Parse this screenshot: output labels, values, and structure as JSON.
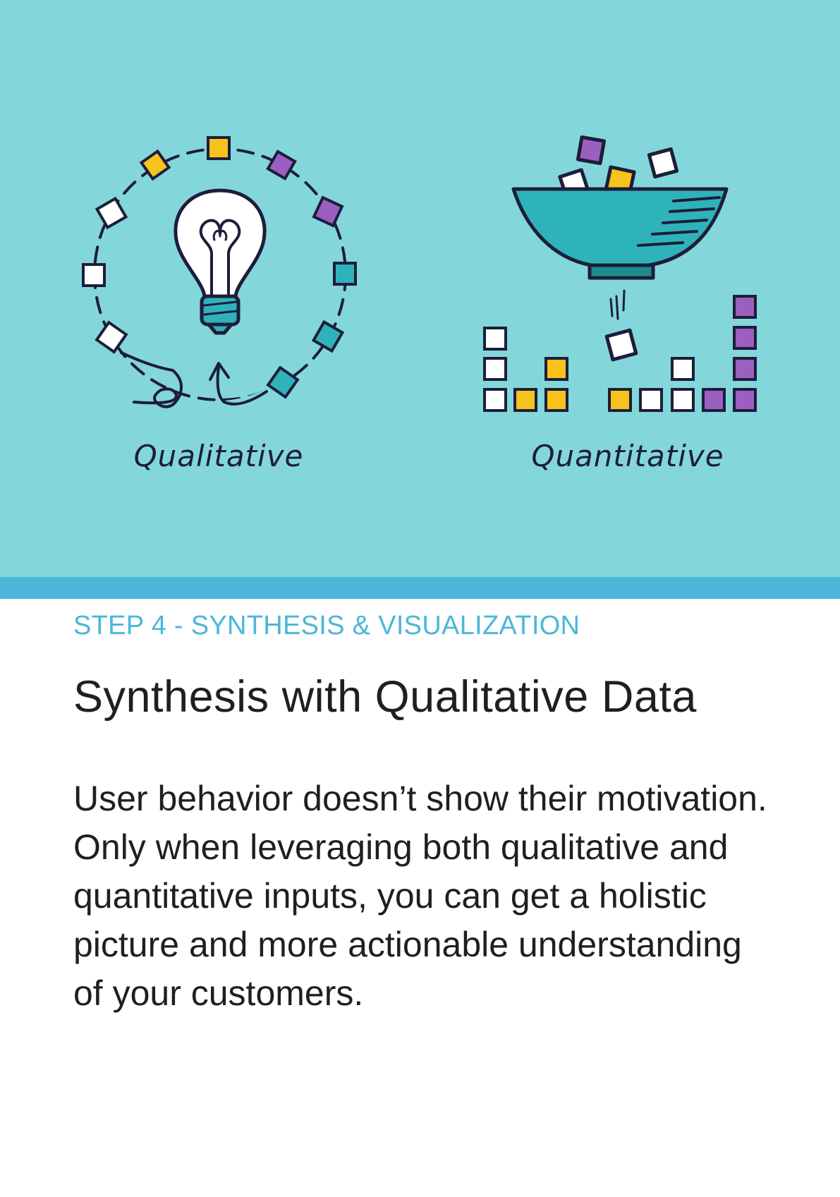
{
  "illustration": {
    "qualitative_label": "Qualitative",
    "quantitative_label": "Quantitative",
    "icons": [
      "lightbulb-icon",
      "funnel-icon"
    ],
    "colors": {
      "background": "#83d7da",
      "band": "#4bb7d9",
      "yellow": "#f6c21c",
      "purple": "#9b5fc0",
      "teal": "#2fb3bb",
      "outline": "#1d1d3a"
    }
  },
  "card": {
    "eyebrow": "STEP 4 - SYNTHESIS & VISUALIZATION",
    "title": "Synthesis with Qualitative Data",
    "body": "User behavior doesn’t show their motivation. Only when leveraging both qualitative and quantitative inputs, you can get a holistic picture and more actionable understanding of your customers."
  }
}
